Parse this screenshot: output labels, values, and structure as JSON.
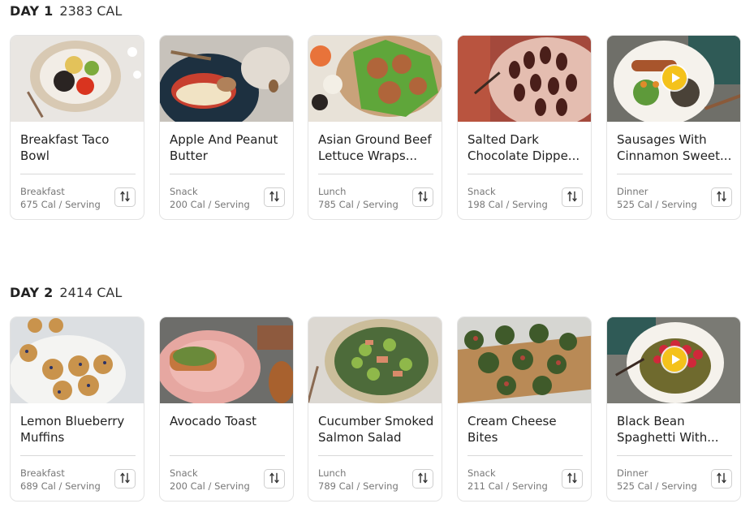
{
  "days": [
    {
      "label": "DAY 1",
      "calories": "2383 CAL",
      "meals": [
        {
          "title_lines": [
            "Breakfast Taco",
            "Bowl"
          ],
          "meal_type": "Breakfast",
          "calories": "675 Cal / Serving",
          "video": false,
          "thumb": "taco-bowl",
          "swap_icon": "swap-icon"
        },
        {
          "title_lines": [
            "Apple And Peanut",
            "Butter"
          ],
          "meal_type": "Snack",
          "calories": "200 Cal / Serving",
          "video": false,
          "thumb": "apple-slices",
          "swap_icon": "swap-icon"
        },
        {
          "title_lines": [
            "Asian Ground Beef",
            "Lettuce Wraps..."
          ],
          "meal_type": "Lunch",
          "calories": "785 Cal / Serving",
          "video": false,
          "thumb": "lettuce-wraps",
          "swap_icon": "swap-icon"
        },
        {
          "title_lines": [
            "Salted Dark",
            "Chocolate Dippe..."
          ],
          "meal_type": "Snack",
          "calories": "198 Cal / Serving",
          "video": false,
          "thumb": "chocolate-dates",
          "swap_icon": "swap-icon"
        },
        {
          "title_lines": [
            "Sausages With",
            "Cinnamon Sweet..."
          ],
          "meal_type": "Dinner",
          "calories": "525 Cal / Serving",
          "video": true,
          "thumb": "sausage-plate",
          "swap_icon": "swap-icon"
        }
      ]
    },
    {
      "label": "DAY 2",
      "calories": "2414 CAL",
      "meals": [
        {
          "title_lines": [
            "Lemon Blueberry",
            "Muffins"
          ],
          "meal_type": "Breakfast",
          "calories": "689 Cal / Serving",
          "video": false,
          "thumb": "muffins",
          "swap_icon": "swap-icon"
        },
        {
          "title_lines": [
            "Avocado Toast",
            ""
          ],
          "meal_type": "Snack",
          "calories": "200 Cal / Serving",
          "video": false,
          "thumb": "avocado-toast",
          "swap_icon": "swap-icon"
        },
        {
          "title_lines": [
            "Cucumber Smoked",
            "Salmon Salad"
          ],
          "meal_type": "Lunch",
          "calories": "789 Cal / Serving",
          "video": false,
          "thumb": "salmon-salad",
          "swap_icon": "swap-icon"
        },
        {
          "title_lines": [
            "Cream Cheese",
            "Bites"
          ],
          "meal_type": "Snack",
          "calories": "211 Cal / Serving",
          "video": false,
          "thumb": "cheese-bites",
          "swap_icon": "swap-icon"
        },
        {
          "title_lines": [
            "Black Bean",
            "Spaghetti With..."
          ],
          "meal_type": "Dinner",
          "calories": "525 Cal / Serving",
          "video": true,
          "thumb": "bean-spaghetti",
          "swap_icon": "swap-icon"
        }
      ]
    }
  ],
  "colors": {
    "play_button": "#f4c21b",
    "card_border": "#e3e3e3",
    "meta_text": "#777777"
  }
}
